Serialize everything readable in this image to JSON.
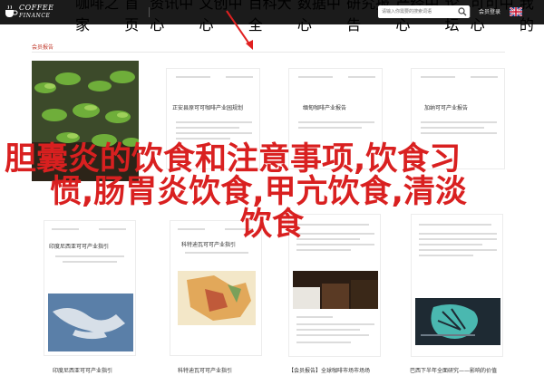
{
  "header": {
    "logo_line1": "COFFEE",
    "logo_line2": "FINANCE",
    "nav": [
      "咖啡之家",
      "首页",
      "资讯中心",
      "文创中心",
      "百科大全",
      "数据中心",
      "研究报告",
      "产经中心",
      "论坛",
      "可可中心",
      "我的"
    ],
    "search_placeholder": "请输入你需要的搜索词语",
    "login": "会员登录",
    "flag_icon": "uk-flag-icon"
  },
  "section": {
    "title": "会员报告"
  },
  "cards": [
    {
      "title": "正安县原可可咖啡产业园规划",
      "caption": ""
    },
    {
      "title": "缅甸咖啡产业报告",
      "caption": ""
    },
    {
      "title": "加纳可可产业报告",
      "caption": ""
    },
    {
      "title": "印度尼西亚可可产业指引",
      "caption": "印度尼西亚可可产业指引"
    },
    {
      "title": "科特迪瓦可可产业指引",
      "caption": "科特迪瓦可可产业指引"
    },
    {
      "title": "",
      "caption": "【会员报告】全球咖啡市场市场场"
    },
    {
      "title": "",
      "caption": "巴西下半年全面研究——影响的价值"
    }
  ],
  "overlay": {
    "line1": "胆囊炎的饮食和注意事项,饮食习",
    "line2": "惯,肠胃炎饮食,甲亢饮食,清淡",
    "line3": "饮食"
  },
  "colors": {
    "topbar": "#1b1b1b",
    "accent": "#c0392b",
    "overlay_text": "#d92020"
  }
}
